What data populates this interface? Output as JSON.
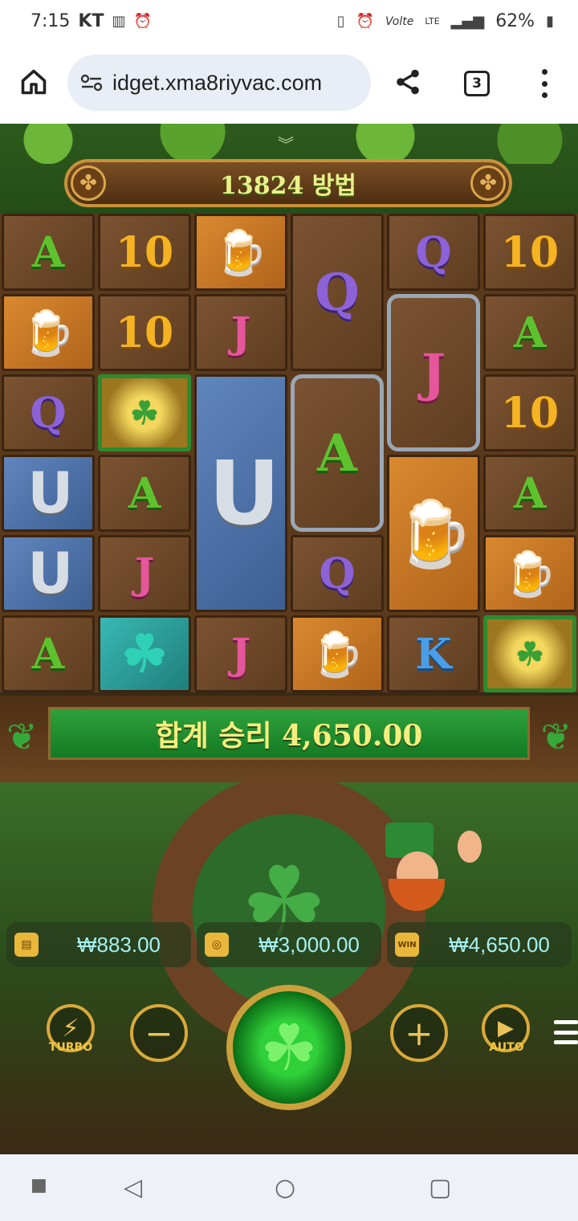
{
  "status": {
    "time": "7:15",
    "carrier": "KT",
    "network": "Volte",
    "lte": "LTE",
    "battery": "62%"
  },
  "browser": {
    "url": "idget.xma8riyvac.com",
    "tab_count": "3"
  },
  "game": {
    "ways_label": "13824 방법",
    "total_win_label": "합계 승리 4,650.00",
    "balance": "₩883.00",
    "bet": "₩3,000.00",
    "win": "₩4,650.00",
    "turbo_label": "TURBO",
    "auto_label": "AUTO",
    "reels": [
      [
        "A",
        "mug",
        "Q",
        "shoe",
        "shoe",
        "A"
      ],
      [
        "10",
        "10",
        "coin",
        "A",
        "J",
        "clover"
      ],
      [
        "mug",
        "J",
        "shoe",
        "J"
      ],
      [
        "Q",
        "A",
        "Q",
        "mug"
      ],
      [
        "Q",
        "J",
        "mug",
        "K"
      ],
      [
        "10",
        "A",
        "10",
        "A",
        "mug",
        "coin"
      ]
    ]
  },
  "icons": {
    "win_icon_text": "WIN"
  }
}
